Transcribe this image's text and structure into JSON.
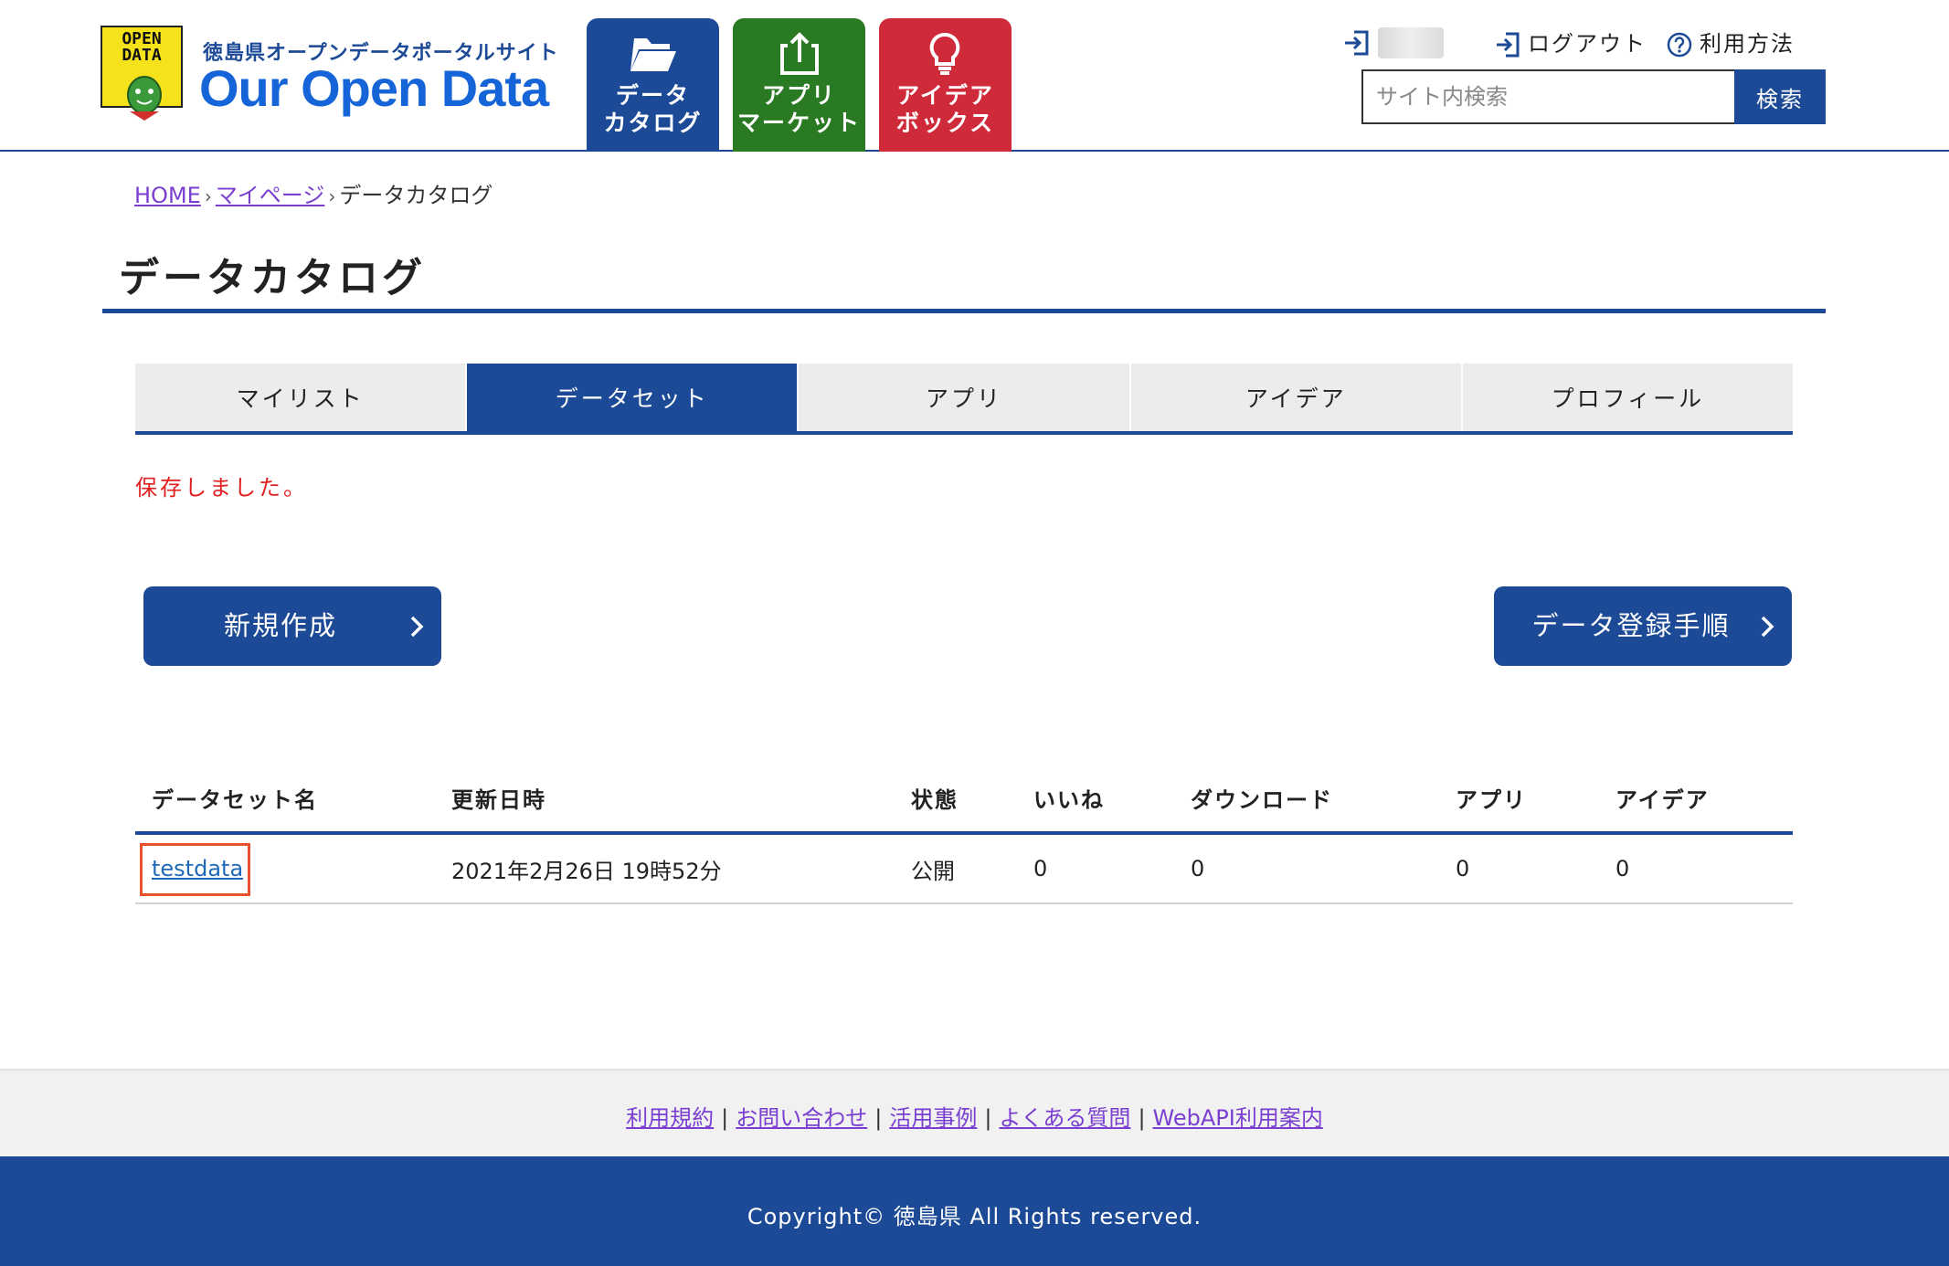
{
  "header": {
    "site_subtitle": "徳島県オープンデータポータルサイト",
    "site_title": "Our Open Data",
    "logo_badge_text": "OPEN\nDATA",
    "nav": [
      {
        "label": "データ\nカタログ",
        "icon": "folder-open-icon",
        "color": "#1c4a96"
      },
      {
        "label": "アプリ\nマーケット",
        "icon": "share-icon",
        "color": "#2a7a23"
      },
      {
        "label": "アイデア\nボックス",
        "icon": "lightbulb-icon",
        "color": "#cf2a3a"
      }
    ],
    "logout_label": "ログアウト",
    "help_label": "利用方法",
    "search_placeholder": "サイト内検索",
    "search_button": "検索"
  },
  "breadcrumb": {
    "home": "HOME",
    "mypage": "マイページ",
    "current": "データカタログ",
    "separator": "›"
  },
  "page_title": "データカタログ",
  "tabs": [
    {
      "label": "マイリスト",
      "active": false
    },
    {
      "label": "データセット",
      "active": true
    },
    {
      "label": "アプリ",
      "active": false
    },
    {
      "label": "アイデア",
      "active": false
    },
    {
      "label": "プロフィール",
      "active": false
    }
  ],
  "message": "保存しました。",
  "buttons": {
    "new": "新規作成",
    "guide": "データ登録手順"
  },
  "table": {
    "headers": [
      "データセット名",
      "更新日時",
      "状態",
      "いいね",
      "ダウンロード",
      "アプリ",
      "アイデア"
    ],
    "rows": [
      [
        "testdata",
        "2021年2月26日 19時52分",
        "公開",
        "0",
        "0",
        "0",
        "0"
      ]
    ]
  },
  "footer": {
    "links": [
      "利用規約",
      "お問い合わせ",
      "活用事例",
      "よくある質問",
      "WebAPI利用案内"
    ],
    "separator": "|",
    "copyright": "Copyright© 徳島県 All Rights reserved."
  },
  "colors": {
    "primary": "#1c4a96",
    "app_green": "#2a7a23",
    "idea_red": "#cf2a3a",
    "message_red": "#e02020",
    "link_purple": "#7a3fd1",
    "highlight_orange": "#e8512a"
  }
}
